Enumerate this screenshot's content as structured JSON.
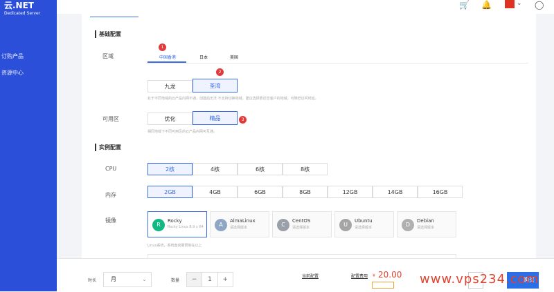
{
  "brand": {
    "name": "云.NET",
    "tagline": "Dedicated Server"
  },
  "sidebar": {
    "items": [
      {
        "label": "订购产品"
      },
      {
        "label": "资源中心"
      }
    ]
  },
  "topbar": {
    "icons": [
      "cart-icon",
      "bell-icon",
      "flag-icon",
      "user-icon"
    ]
  },
  "sections": {
    "basic": "基础配置",
    "instance": "实例配置"
  },
  "region": {
    "label": "区域",
    "tabs": [
      "中国香港",
      "日本",
      "美国"
    ],
    "active_tab": "中国香港",
    "areas": [
      "九龙",
      "荃湾"
    ],
    "selected_area": "荃湾",
    "area_note": "处于不同地域的云产品内网不通，创建后无法 不支持切换地域，建议选择靠近您客户的地域，可降低访问时延。"
  },
  "zone": {
    "label": "可用区",
    "options": [
      "优化",
      "精品"
    ],
    "selected": "精品",
    "note": "相同地域下不同可用区的云产品内网可互通。"
  },
  "cpu": {
    "label": "CPU",
    "options": [
      "2核",
      "4核",
      "6核",
      "8核"
    ],
    "selected": "2核"
  },
  "memory": {
    "label": "内存",
    "options": [
      "2GB",
      "4GB",
      "6GB",
      "8GB",
      "12GB",
      "14GB",
      "16GB"
    ],
    "selected": "2GB"
  },
  "image": {
    "label": "镜像",
    "options": [
      {
        "name": "Rocky",
        "sub": "Rocky Linux 8.9 x 64",
        "icon": "rocky-icon"
      },
      {
        "name": "AlmaLinux",
        "sub": "请选择版本",
        "icon": "almalinux-icon"
      },
      {
        "name": "CentOS",
        "sub": "请选择版本",
        "icon": "centos-icon"
      },
      {
        "name": "Ubuntu",
        "sub": "请选择版本",
        "icon": "ubuntu-icon"
      },
      {
        "name": "Debian",
        "sub": "请选择版本",
        "icon": "debian-icon"
      }
    ],
    "selected": "Rocky",
    "note": "Linux系统，系统盘容量限制在以上"
  },
  "badges": [
    "1",
    "2",
    "3"
  ],
  "footer": {
    "duration_label": "时长",
    "duration_value": "月",
    "quantity_label": "数量",
    "quantity_value": "1",
    "current_config": "当前配置",
    "fee_label": "配置费用",
    "currency": "¥",
    "price": "20.00",
    "buy_label": "购买"
  },
  "watermark": "www.vps234.com",
  "colors": {
    "brand": "#2b4fd8",
    "accent": "#3a6be6",
    "badge": "#e03a3a",
    "price": "#e0422f"
  }
}
